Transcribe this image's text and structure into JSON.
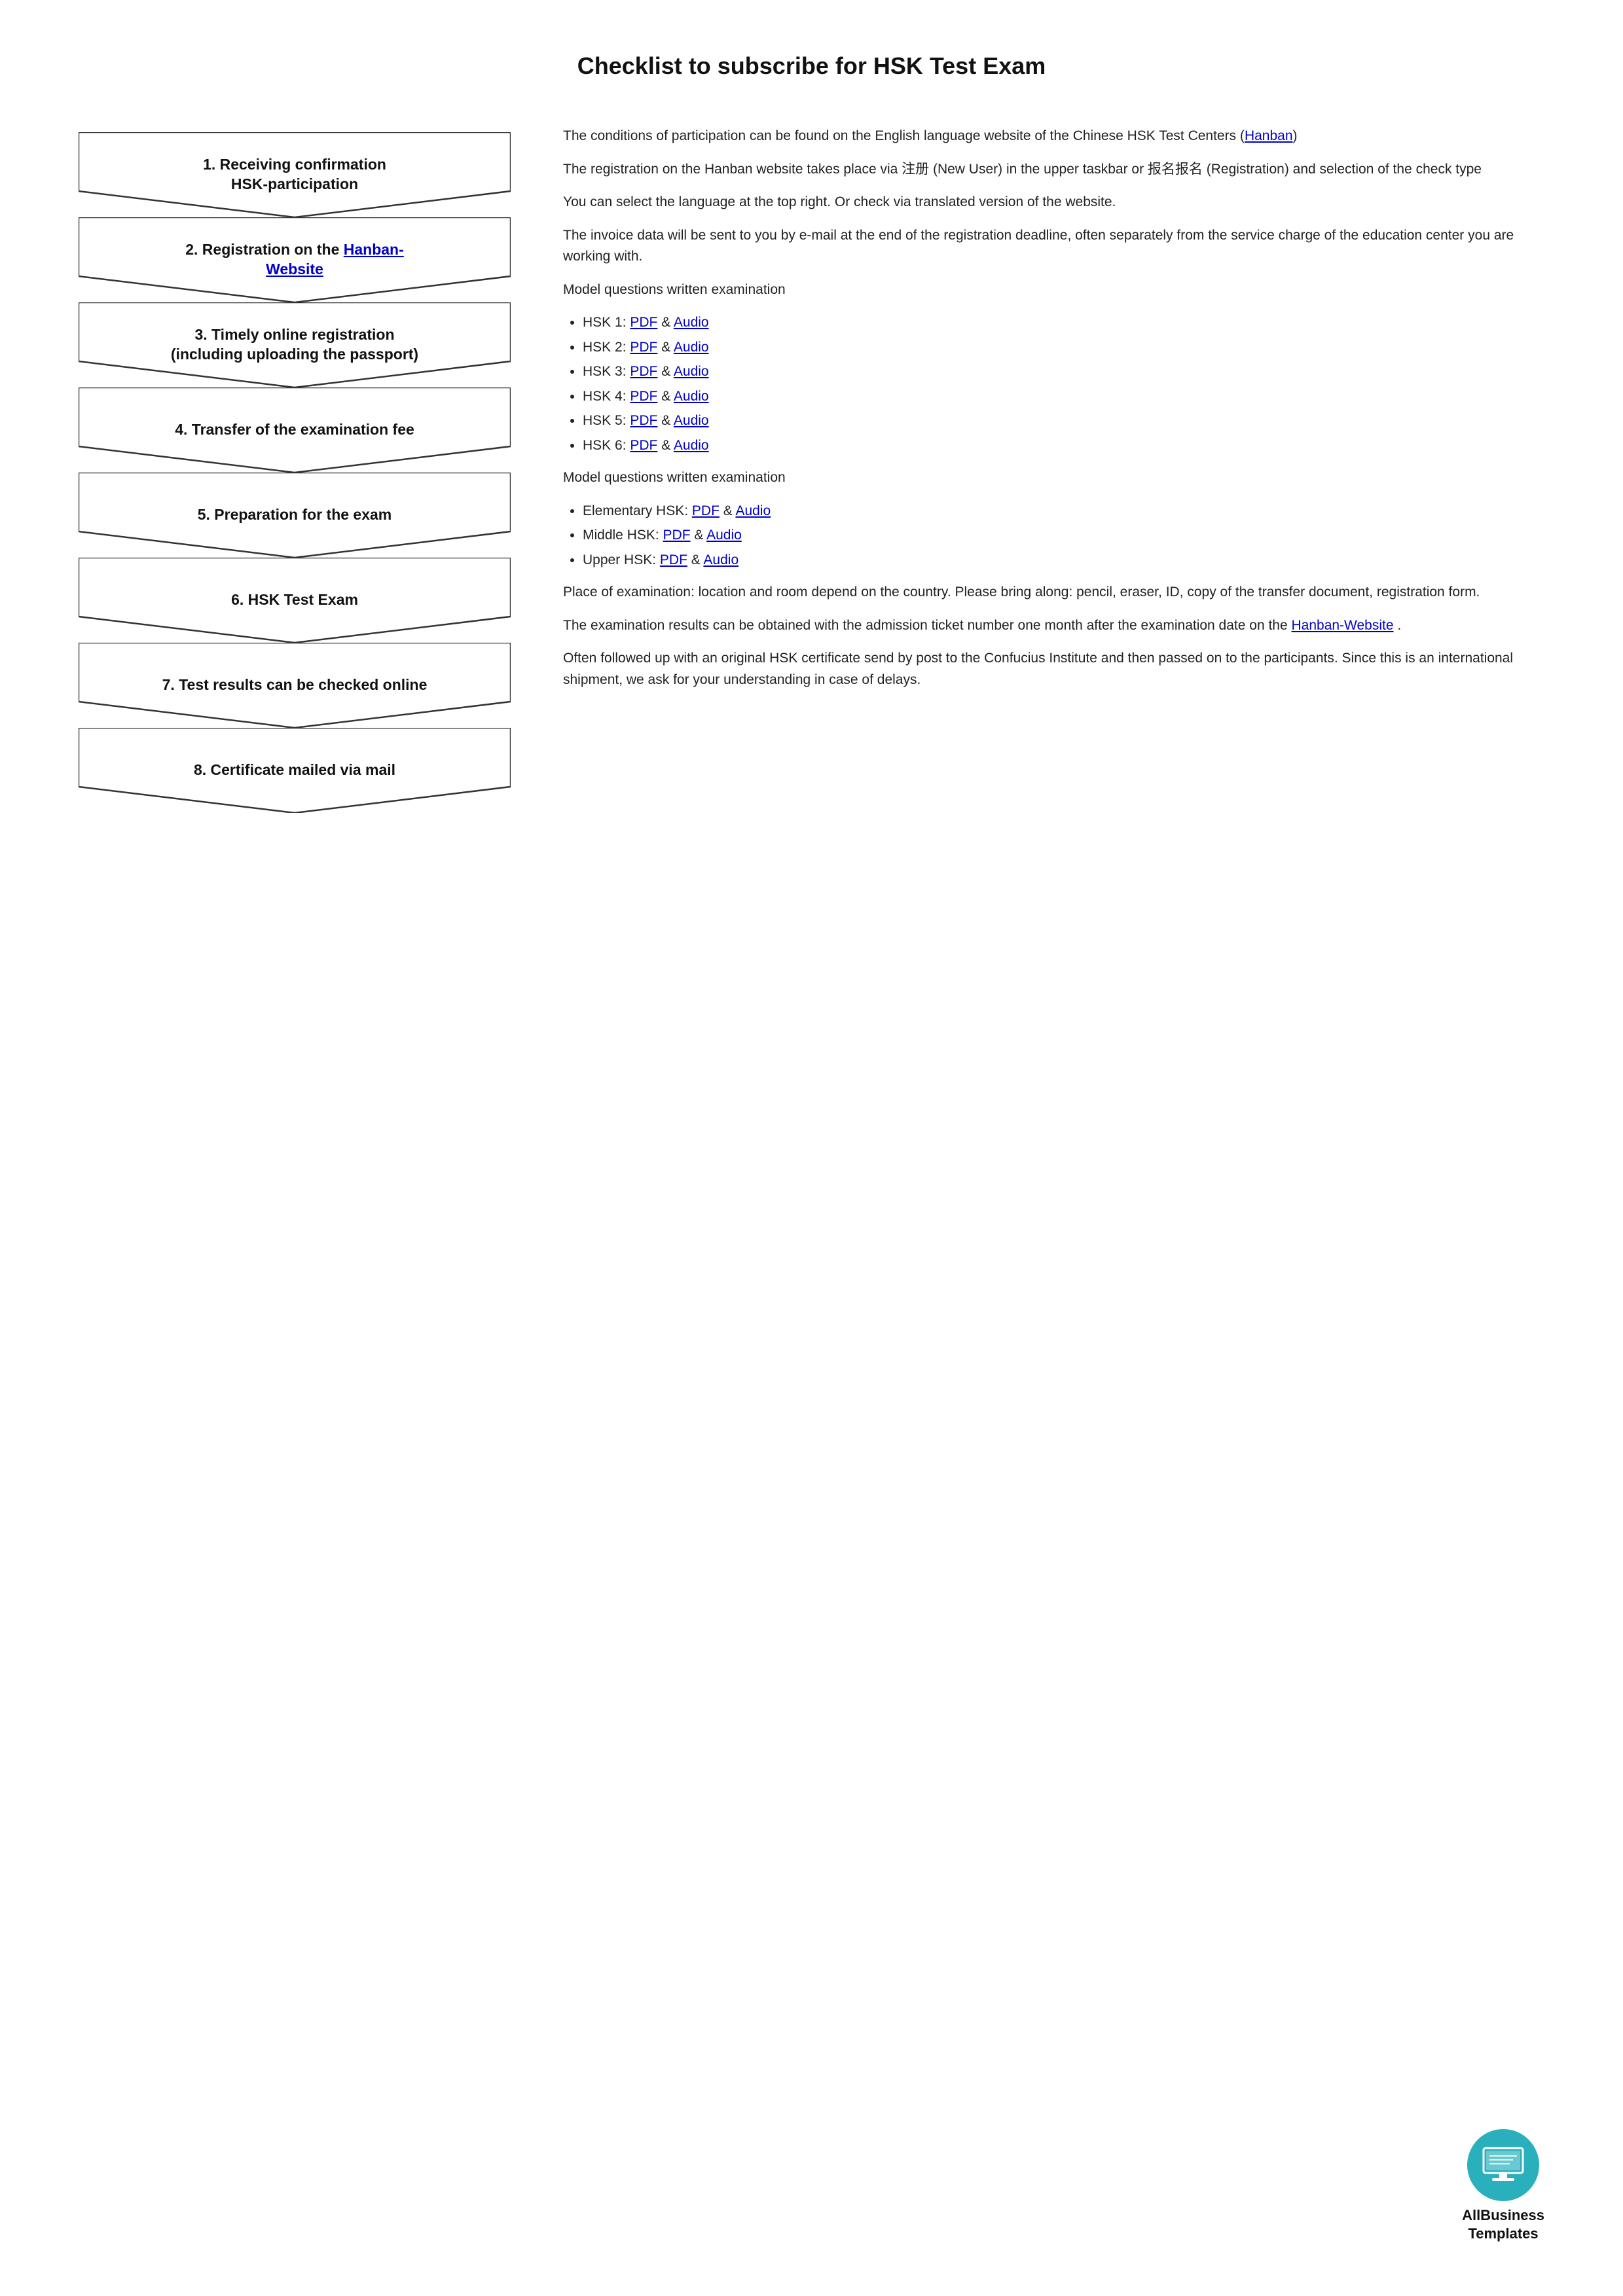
{
  "title": "Checklist to subscribe for HSK Test Exam",
  "steps": [
    {
      "id": 1,
      "label": "1. Receiving confirmation\nHSK-participation",
      "has_link": false
    },
    {
      "id": 2,
      "label": "2. Registration on the ",
      "link_text": "Hanban-\nWebsite",
      "link_url": "#",
      "after_link": "",
      "has_link": true
    },
    {
      "id": 3,
      "label": "3. Timely online registration\n(including uploading the passport)",
      "has_link": false
    },
    {
      "id": 4,
      "label": "4. Transfer of the examination fee",
      "has_link": false
    },
    {
      "id": 5,
      "label": "5. Preparation for the exam",
      "has_link": false
    },
    {
      "id": 6,
      "label": "6. HSK Test Exam",
      "has_link": false
    },
    {
      "id": 7,
      "label": "7. Test results can be checked online",
      "has_link": false
    },
    {
      "id": 8,
      "label": "8. Certificate mailed via mail",
      "has_link": false
    }
  ],
  "right": {
    "para1": "The conditions of participation can be found on the English language website of the Chinese HSK Test Centers  (",
    "para1_link": "Hanban",
    "para1_after": ")",
    "para2": "The registration on the Hanban website takes place via 注册 (New User) in the upper taskbar or 报名报名 (Registration) and selection of the check type",
    "para3": "You can select the language at the top right. Or check via translated version of the website.",
    "para4": "The invoice data will be sent to you by e-mail at the end of the registration deadline, often separately from the service charge of the education center you are working with.",
    "section1_header": "Model questions written examination",
    "hsk_items": [
      {
        "label": "HSK 1: ",
        "pdf_text": "PDF",
        "amp": " & ",
        "audio_text": "Audio"
      },
      {
        "label": "HSK 2: ",
        "pdf_text": "PDF",
        "amp": " & ",
        "audio_text": "Audio"
      },
      {
        "label": "HSK 3: ",
        "pdf_text": "PDF",
        "amp": " & ",
        "audio_text": "Audio"
      },
      {
        "label": "HSK 4: ",
        "pdf_text": "PDF",
        "amp": " & ",
        "audio_text": "Audio"
      },
      {
        "label": "HSK 5: ",
        "pdf_text": "PDF",
        "amp": " & ",
        "audio_text": "Audio"
      },
      {
        "label": "HSK 6: ",
        "pdf_text": "PDF",
        "amp": " & ",
        "audio_text": "Audio"
      }
    ],
    "section2_header": "Model questions written examination",
    "hsk_items2": [
      {
        "label": "Elementary HSK: ",
        "pdf_text": "PDF",
        "amp": " & ",
        "audio_text": "Audio"
      },
      {
        "label": "Middle HSK: ",
        "pdf_text": "PDF",
        "amp": " & ",
        "audio_text": "Audio"
      },
      {
        "label": "Upper HSK: ",
        "pdf_text": "PDF",
        "amp": " & ",
        "audio_text": "Audio"
      }
    ],
    "para5": "Place of examination: location and room depend on the country. Please bring along: pencil, eraser, ID, copy of the transfer document, registration form.",
    "para6_before": "The examination results can be obtained with the admission ticket number one month after the examination date on the ",
    "para6_link": "Hanban-Website",
    "para6_after": " .",
    "para7": "Often followed up with an original HSK certificate send by post to the Confucius Institute and then passed on to the participants. Since this is an international shipment, we ask for your understanding in case of delays."
  },
  "logo": {
    "text_line1": "AllBusiness",
    "text_line2": "Templates"
  }
}
